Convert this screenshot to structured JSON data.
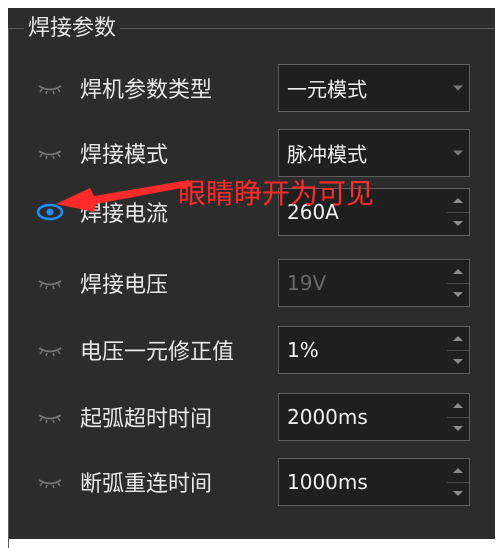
{
  "group_title": "焊接参数",
  "colors": {
    "panel_bg": "#2c2c2c",
    "eye_active": "#1e90ff",
    "eye_inactive": "#777777",
    "annotation_red": "#ff2a2a"
  },
  "rows": [
    {
      "label": "焊机参数类型",
      "value": "一元模式",
      "control": "combo",
      "eye": "closed-eye-icon"
    },
    {
      "label": "焊接模式",
      "value": "脉冲模式",
      "control": "combo",
      "eye": "closed-eye-icon"
    },
    {
      "label": "焊接电流",
      "value": "260A",
      "control": "spin",
      "eye": "open-eye-icon"
    },
    {
      "label": "焊接电压",
      "value": "19V",
      "control": "spin-disabled",
      "eye": "closed-eye-icon"
    },
    {
      "label": "电压一元修正值",
      "value": "1%",
      "control": "spin",
      "eye": "closed-eye-icon"
    },
    {
      "label": "起弧超时时间",
      "value": "2000ms",
      "control": "spin",
      "eye": "closed-eye-icon"
    },
    {
      "label": "断弧重连时间",
      "value": "1000ms",
      "control": "spin",
      "eye": "closed-eye-icon"
    }
  ],
  "annotation": {
    "text": "眼睛睁开为可见"
  }
}
